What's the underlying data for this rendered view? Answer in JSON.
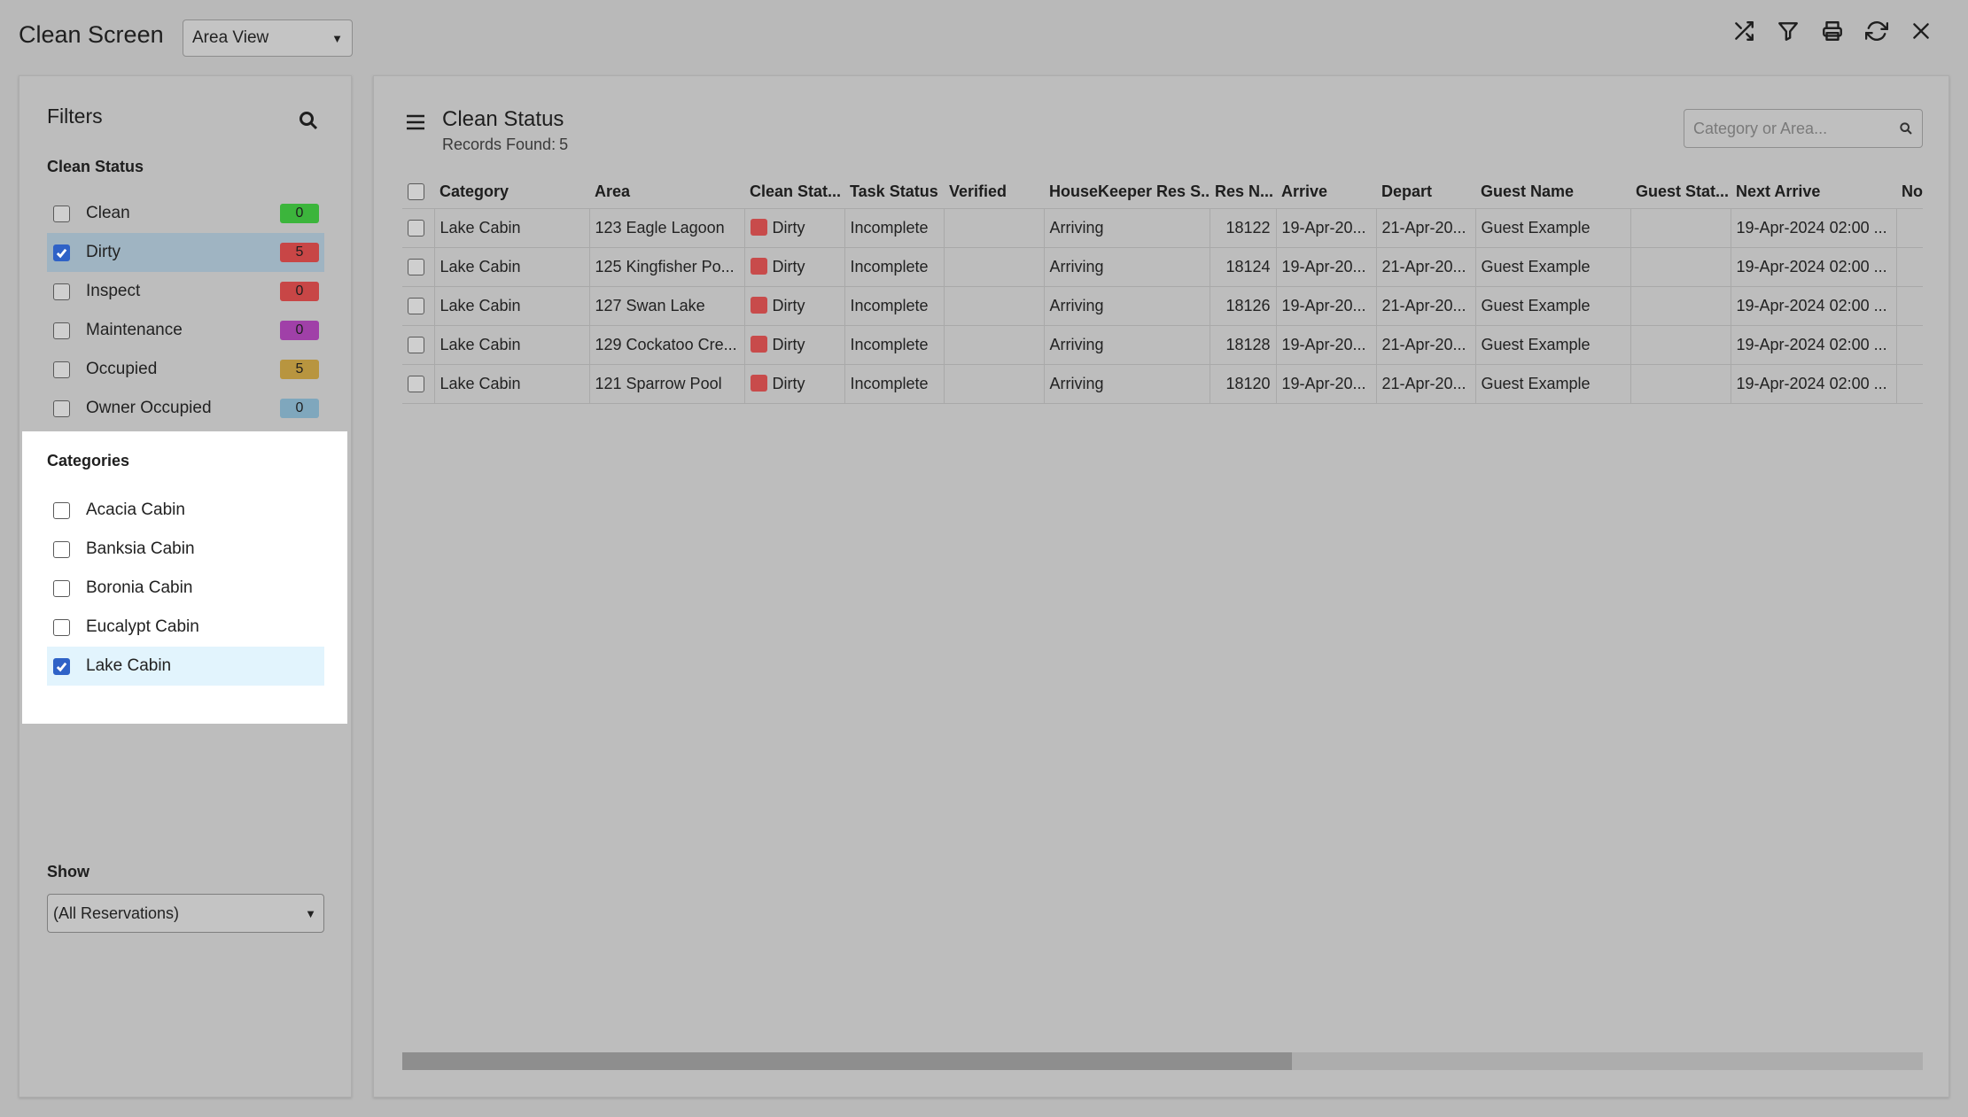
{
  "app": {
    "title": "Clean Screen",
    "view_select": "Area View"
  },
  "toolbar": {
    "icons": [
      "shuffle-icon",
      "filter-icon",
      "print-icon",
      "refresh-icon",
      "close-icon"
    ]
  },
  "filters": {
    "title": "Filters",
    "clean_status_label": "Clean Status",
    "clean_status": [
      {
        "label": "Clean",
        "count": "0",
        "checked": false,
        "color": "#3cb53c"
      },
      {
        "label": "Dirty",
        "count": "5",
        "checked": true,
        "color": "#c84646"
      },
      {
        "label": "Inspect",
        "count": "0",
        "checked": false,
        "color": "#c84646"
      },
      {
        "label": "Maintenance",
        "count": "0",
        "checked": false,
        "color": "#a040a8"
      },
      {
        "label": "Occupied",
        "count": "5",
        "checked": false,
        "color": "#b8953f"
      },
      {
        "label": "Owner Occupied",
        "count": "0",
        "checked": false,
        "color": "#7fa7bd"
      }
    ],
    "categories_label": "Categories",
    "categories": [
      {
        "label": "Acacia Cabin",
        "checked": false
      },
      {
        "label": "Banksia Cabin",
        "checked": false
      },
      {
        "label": "Boronia Cabin",
        "checked": false
      },
      {
        "label": "Eucalypt Cabin",
        "checked": false
      },
      {
        "label": "Lake Cabin",
        "checked": true
      }
    ],
    "show_label": "Show",
    "show_value": "(All Reservations)"
  },
  "main": {
    "title": "Clean Status",
    "records_label": "Records Found:",
    "records_count": "5",
    "search_placeholder": "Category or Area...",
    "columns": [
      "Category",
      "Area",
      "Clean Stat...",
      "Task Status",
      "Verified",
      "HouseKeeper Res S...",
      "Res N...",
      "Arrive",
      "Depart",
      "Guest Name",
      "Guest Stat...",
      "Next Arrive",
      "No"
    ],
    "rows": [
      {
        "category": "Lake Cabin",
        "area": "123 Eagle Lagoon",
        "clean_status": "Dirty",
        "task_status": "Incomplete",
        "verified": "",
        "housekeeper_res_status": "Arriving",
        "res_no": "18122",
        "arrive": "19-Apr-20...",
        "depart": "21-Apr-20...",
        "guest_name": "Guest Example",
        "guest_status": "",
        "next_arrive": "19-Apr-2024 02:00 ...",
        "no": ""
      },
      {
        "category": "Lake Cabin",
        "area": "125 Kingfisher Po...",
        "clean_status": "Dirty",
        "task_status": "Incomplete",
        "verified": "",
        "housekeeper_res_status": "Arriving",
        "res_no": "18124",
        "arrive": "19-Apr-20...",
        "depart": "21-Apr-20...",
        "guest_name": "Guest Example",
        "guest_status": "",
        "next_arrive": "19-Apr-2024 02:00 ...",
        "no": ""
      },
      {
        "category": "Lake Cabin",
        "area": "127 Swan Lake",
        "clean_status": "Dirty",
        "task_status": "Incomplete",
        "verified": "",
        "housekeeper_res_status": "Arriving",
        "res_no": "18126",
        "arrive": "19-Apr-20...",
        "depart": "21-Apr-20...",
        "guest_name": "Guest Example",
        "guest_status": "",
        "next_arrive": "19-Apr-2024 02:00 ...",
        "no": ""
      },
      {
        "category": "Lake Cabin",
        "area": "129 Cockatoo Cre...",
        "clean_status": "Dirty",
        "task_status": "Incomplete",
        "verified": "",
        "housekeeper_res_status": "Arriving",
        "res_no": "18128",
        "arrive": "19-Apr-20...",
        "depart": "21-Apr-20...",
        "guest_name": "Guest Example",
        "guest_status": "",
        "next_arrive": "19-Apr-2024 02:00 ...",
        "no": ""
      },
      {
        "category": "Lake Cabin",
        "area": "121 Sparrow Pool",
        "clean_status": "Dirty",
        "task_status": "Incomplete",
        "verified": "",
        "housekeeper_res_status": "Arriving",
        "res_no": "18120",
        "arrive": "19-Apr-20...",
        "depart": "21-Apr-20...",
        "guest_name": "Guest Example",
        "guest_status": "",
        "next_arrive": "19-Apr-2024 02:00 ...",
        "no": ""
      }
    ],
    "dirty_color": "#c84b4b",
    "hscroll_fraction": 0.585
  }
}
